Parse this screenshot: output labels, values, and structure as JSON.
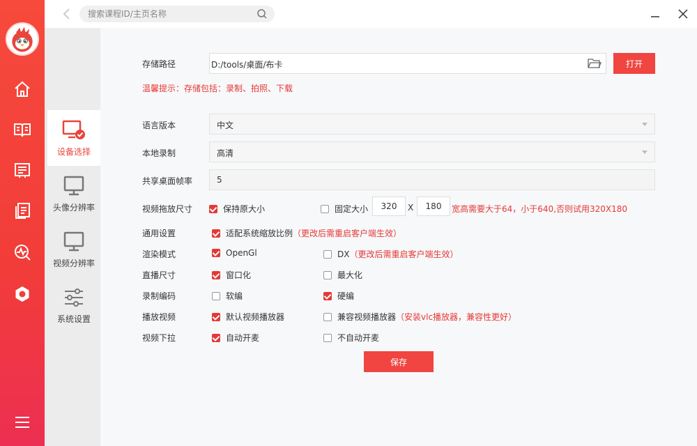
{
  "search": {
    "placeholder": "搜索课程ID/主页名称"
  },
  "subnav": [
    {
      "label": "设备选择",
      "active": true
    },
    {
      "label": "头像分辨率",
      "active": false
    },
    {
      "label": "视频分辨率",
      "active": false
    },
    {
      "label": "系统设置",
      "active": false
    }
  ],
  "settings": {
    "storage_label": "存储路径",
    "storage_path": "D:/tools/桌面/布卡",
    "open_button": "打开",
    "hint": "温馨提示：存储包括：录制、拍照、下载",
    "language_label": "语言版本",
    "language_value": "中文",
    "record_label": "本地录制",
    "record_value": "高清",
    "fps_label": "共享桌面帧率",
    "fps_value": "5",
    "video_size_label": "视频拖放尺寸",
    "keep_size": "保持原大小",
    "fixed_size": "固定大小",
    "width": "320",
    "times": "X",
    "height": "180",
    "size_hint": "宽高需要大于64，小于640,否则试用320X180",
    "general_label": "通用设置",
    "scale_option": "适配系统缩放比例",
    "restart_note": "（更改后需重启客户端生效）",
    "render_label": "渲染模式",
    "opengl": "OpenGl",
    "dx": "DX",
    "live_label": "直播尺寸",
    "windowed": "窗口化",
    "maximize": "最大化",
    "encode_label": "录制编码",
    "soft": "软编",
    "hard": "硬编",
    "player_label": "播放视频",
    "default_player": "默认视频播放器",
    "compat_player": "兼容视频播放器",
    "vlc_note": "（安装vlc播放器，兼容性更好）",
    "pull_label": "视频下拉",
    "auto_mic": "自动开麦",
    "no_auto_mic": "不自动开麦",
    "save_button": "保存"
  },
  "checks": {
    "keep_size": true,
    "fixed_size": false,
    "scale": true,
    "opengl": true,
    "dx": false,
    "windowed": true,
    "maximize": false,
    "soft": false,
    "hard": true,
    "default_player": true,
    "compat_player": false,
    "auto_mic": true,
    "no_auto_mic": false
  },
  "colors": {
    "accent": "#f04540",
    "rail_top": "#f64a3c",
    "rail_bottom": "#ec2f52",
    "subnav_bg": "#ececec"
  },
  "icons": [
    "home-icon",
    "book-icon",
    "list-icon",
    "document-icon",
    "analytics-icon",
    "settings-icon",
    "menu-icon",
    "back-icon",
    "search-icon",
    "minimize-icon",
    "close-icon",
    "folder-icon"
  ]
}
